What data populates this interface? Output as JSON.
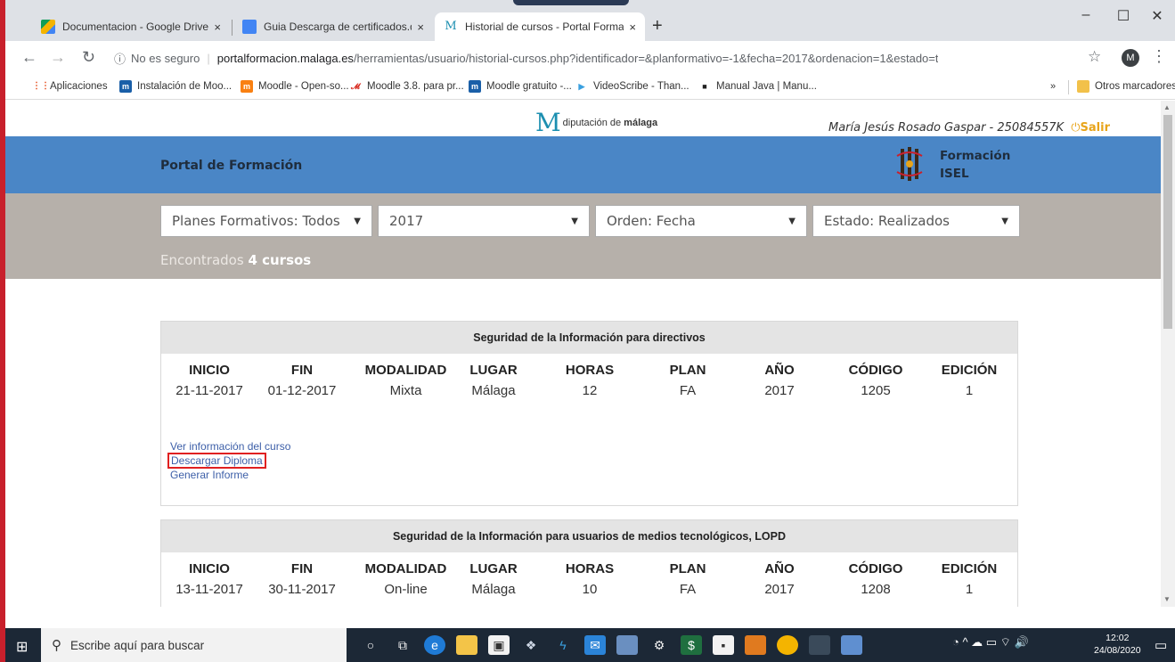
{
  "browser": {
    "tabs": [
      {
        "title": "Documentacion - Google Drive",
        "icon": "google-drive-icon",
        "color": "#f4b400"
      },
      {
        "title": "Guia Descarga de certificados.do",
        "icon": "google-docs-icon",
        "color": "#4285f4"
      },
      {
        "title": "Historial de cursos - Portal Forma",
        "icon": "diputacion-m-icon",
        "color": "#1c8fb0"
      }
    ],
    "tab_close": "×",
    "new_tab": "+",
    "window_controls": {
      "minimize": "–",
      "maximize": "☐",
      "close": "✕"
    },
    "nav": {
      "back": "←",
      "forward": "→",
      "reload": "↻"
    },
    "omnibox": {
      "info": "ⓘ",
      "insecure_label": "No es seguro",
      "host": "portalformacion.malaga.es",
      "path": "/herramientas/usuario/historial-cursos.php?identificador=&planformativo=-1&fecha=2017&ordenacion=1&estado=t"
    },
    "star": "☆",
    "profile_initial": "M",
    "menu": "⋮",
    "bookmarks": [
      {
        "label": "Aplicaciones",
        "icon": "apps-icon",
        "color": "#e64a19",
        "glyph": "⋮⋮"
      },
      {
        "label": "Instalación de Moo...",
        "icon": "moodle-icon",
        "color": "#1a5fa8",
        "glyph": "m"
      },
      {
        "label": "Moodle - Open-so...",
        "icon": "moodle-icon",
        "color": "#f98012",
        "glyph": "m"
      },
      {
        "label": "Moodle 3.8. para pr...",
        "icon": "bookmark-icon",
        "color": "#d93025",
        "glyph": "𝓜"
      },
      {
        "label": "Moodle gratuito -...",
        "icon": "moodle-icon",
        "color": "#1a5fa8",
        "glyph": "m"
      },
      {
        "label": "VideoScribe - Than...",
        "icon": "play-icon",
        "color": "#3aa0e0",
        "glyph": "▶"
      },
      {
        "label": "Manual Java | Manu...",
        "icon": "book-icon",
        "color": "#222",
        "glyph": "■"
      }
    ],
    "bookmarks_more": "»",
    "other_bookmarks": "Otros marcadores"
  },
  "site": {
    "logo_text_light": "diputación de ",
    "logo_text_bold": "málaga",
    "user": "María Jesús Rosado Gaspar - 25084557K",
    "logout": "Salir",
    "portal_title": "Portal de Formación",
    "isel_line1": "Formación",
    "isel_line2": "ISEL"
  },
  "filters": {
    "plan": "Planes Formativos: Todos",
    "year": "2017",
    "order": "Orden: Fecha",
    "state": "Estado: Realizados"
  },
  "found_prefix": "Encontrados ",
  "found_count": "4 cursos",
  "columns": [
    "INICIO",
    "FIN",
    "MODALIDAD",
    "LUGAR",
    "HORAS",
    "PLAN",
    "AÑO",
    "CÓDIGO",
    "EDICIÓN"
  ],
  "courses": [
    {
      "title": "Seguridad de la Información para directivos",
      "values": [
        "21-11-2017",
        "01-12-2017",
        "Mixta",
        "Málaga",
        "12",
        "FA",
        "2017",
        "1205",
        "1"
      ],
      "links": {
        "info": "Ver información del curso",
        "diploma": "Descargar Diploma",
        "report": "Generar Informe"
      }
    },
    {
      "title": "Seguridad de la Información para usuarios de medios tecnológicos, LOPD",
      "values": [
        "13-11-2017",
        "30-11-2017",
        "On-line",
        "Málaga",
        "10",
        "FA",
        "2017",
        "1208",
        "1"
      ]
    }
  ],
  "taskbar": {
    "search_placeholder": "Escribe aquí para buscar",
    "time": "12:02",
    "date": "24/08/2020"
  }
}
